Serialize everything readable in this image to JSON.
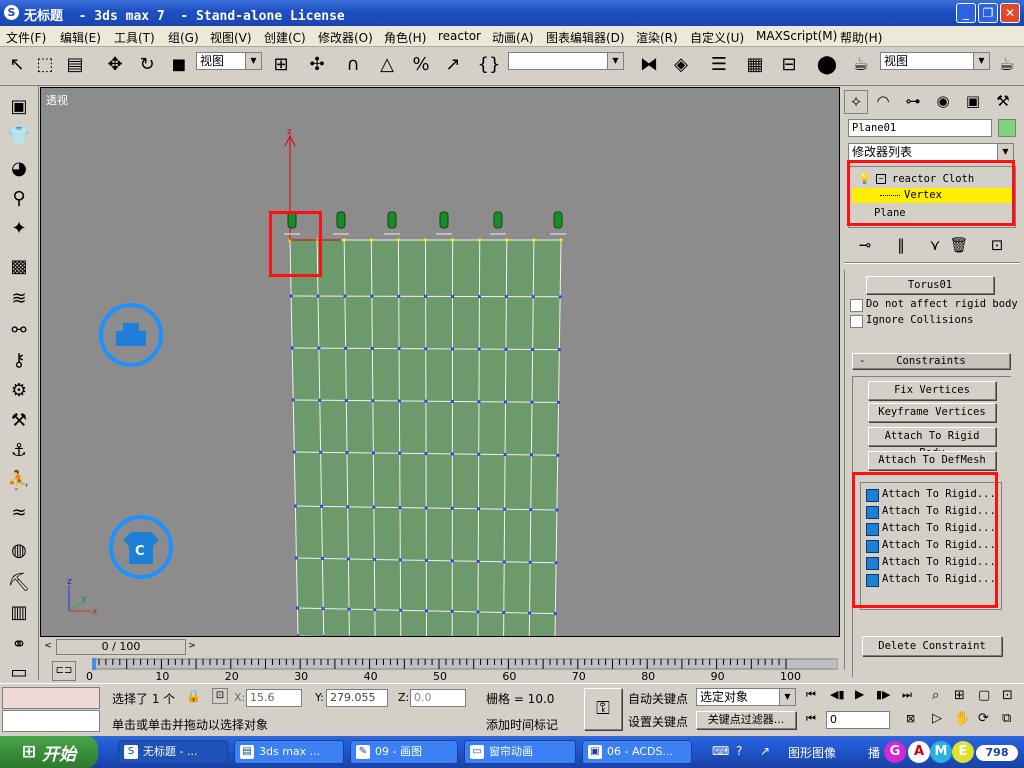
{
  "window": {
    "title": "无标题  - 3ds max 7  - Stand-alone License",
    "min": "_",
    "max": "❐",
    "close": "✕"
  },
  "menu": [
    "文件(F)",
    "编辑(E)",
    "工具(T)",
    "组(G)",
    "视图(V)",
    "创建(C)",
    "修改器(O)",
    "角色(H)",
    "reactor",
    "动画(A)",
    "图表编辑器(D)",
    "渲染(R)",
    "自定义(U)",
    "MAXScript(M)",
    "帮助(H)"
  ],
  "toolbar": {
    "view_dropdown": "视图",
    "selection_set_dropdown": "",
    "view_dropdown2": "视图"
  },
  "viewport": {
    "label": "透视",
    "axis_z": "z",
    "gizmo_z": "z",
    "gizmo_y": "y",
    "gizmo_x": "x",
    "marker_c": "C"
  },
  "timeslider": {
    "label": "0 / 100"
  },
  "ruler": {
    "ticks": [
      "0",
      "10",
      "20",
      "30",
      "40",
      "50",
      "60",
      "70",
      "80",
      "90",
      "100"
    ]
  },
  "panel": {
    "object_name": "Plane01",
    "modifier_list": "修改器列表",
    "stack": [
      {
        "label": "reactor Cloth",
        "selected": false
      },
      {
        "label": "Vertex",
        "selected": true
      },
      {
        "label": "Plane",
        "selected": false
      }
    ],
    "torus_button": "Torus01",
    "check_no_affect": "Do not affect rigid body",
    "check_ignore": "Ignore Collisions",
    "rollout_constraints": "Constraints",
    "rollout_sign": "-",
    "buttons": [
      "Fix Vertices",
      "Keyframe Vertices",
      "Attach To Rigid Body",
      "Attach To DefMesh"
    ],
    "constraint_list": [
      "Attach To Rigid...",
      "Attach To Rigid...",
      "Attach To Rigid...",
      "Attach To Rigid...",
      "Attach To Rigid...",
      "Attach To Rigid..."
    ],
    "delete_button": "Delete Constraint"
  },
  "status": {
    "selected": "选择了 1 个",
    "x_label": "X:",
    "x_val": "15.6",
    "y_label": "Y:",
    "y_val": "279.055",
    "z_label": "Z:",
    "z_val": "0.0",
    "grid": "栅格 = 10.0",
    "autokey": "自动关键点",
    "setkey": "设置关键点",
    "selected_obj": "选定对象",
    "key_filter": "关键点过滤器...",
    "prompt": "单击或单击并拖动以选择对象",
    "add_time_tag": "添加时间标记",
    "frame": "0"
  },
  "taskbar": {
    "start": "开始",
    "tasks": [
      "无标题 - ...",
      "3ds max ...",
      "09 - 画图",
      "窗帘动画",
      "06 - ACDS..."
    ],
    "tray_text": "图形图像",
    "tray_text2": "播",
    "game": [
      "G",
      "A",
      "M",
      "E"
    ],
    "game_num": "798"
  },
  "colors": {
    "highlight_red": "#ff1010",
    "cloth_green": "#6d9a6d",
    "viewport_bg": "#8c8c8c"
  }
}
